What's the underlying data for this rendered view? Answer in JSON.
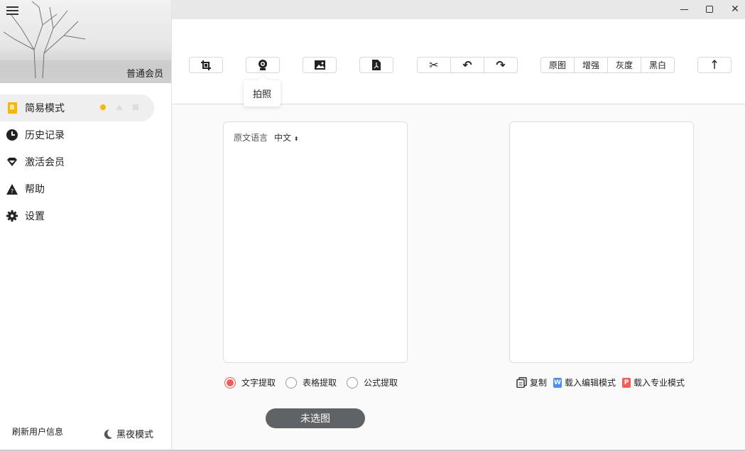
{
  "sidebar": {
    "member_label": "普通会员",
    "items": [
      {
        "label": "简易模式",
        "icon": "b-doc-icon"
      },
      {
        "label": "历史记录",
        "icon": "clock-icon"
      },
      {
        "label": "激活会员",
        "icon": "diamond-icon"
      },
      {
        "label": "帮助",
        "icon": "warning-help-icon"
      },
      {
        "label": "设置",
        "icon": "gear-icon"
      }
    ],
    "refresh_label": "刷新用户信息",
    "dark_mode_label": "黑夜模式"
  },
  "toolbar": {
    "tooltip": "拍照",
    "filters": [
      "原图",
      "增强",
      "灰度",
      "黑白"
    ]
  },
  "source_panel": {
    "lang_label": "原文语言",
    "lang_value": "中文"
  },
  "modes": [
    {
      "label": "文字提取",
      "selected": true
    },
    {
      "label": "表格提取",
      "selected": false
    },
    {
      "label": "公式提取",
      "selected": false
    }
  ],
  "actions": {
    "copy": "复制",
    "word": "载入编辑模式",
    "word_badge": "W",
    "pro": "载入专业模式",
    "pro_badge": "P"
  },
  "submit_label": "未选图",
  "colors": {
    "accent": "#f45b5b",
    "yellow": "#f6b800",
    "word": "#4a8ef5",
    "button": "#5f6366"
  }
}
